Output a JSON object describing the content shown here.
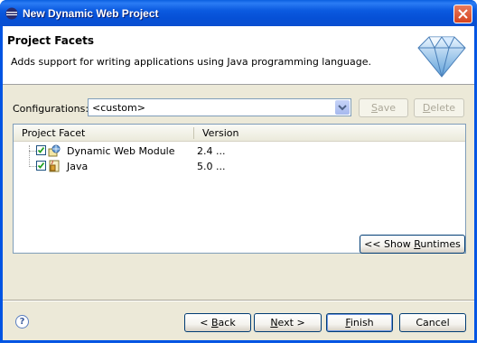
{
  "window": {
    "title": "New Dynamic Web Project"
  },
  "banner": {
    "title": "Project Facets",
    "description": "Adds support for writing applications using Java programming language."
  },
  "configurations": {
    "label": "Configurations:",
    "selected": "<custom>",
    "save_pre": "",
    "save_key": "S",
    "save_post": "ave",
    "delete_pre": "",
    "delete_key": "D",
    "delete_post": "elete"
  },
  "facets_table": {
    "columns": [
      "Project Facet",
      "Version"
    ],
    "rows": [
      {
        "name": "Dynamic Web Module",
        "version": "2.4 ...",
        "checked": true
      },
      {
        "name": "Java",
        "version": "5.0 ...",
        "checked": true
      }
    ]
  },
  "runtimes_button": {
    "pre": "<< Show ",
    "key": "R",
    "post": "untimes"
  },
  "footer": {
    "help_symbol": "?",
    "back": {
      "pre": "< ",
      "key": "B",
      "post": "ack"
    },
    "next": {
      "pre": "",
      "key": "N",
      "post": "ext >"
    },
    "finish": {
      "pre": "",
      "key": "F",
      "post": "inish"
    },
    "cancel": "Cancel"
  },
  "colors": {
    "title_bar": "#0054e3",
    "dialog_bg": "#ece9d8",
    "close_button": "#d6441f"
  }
}
